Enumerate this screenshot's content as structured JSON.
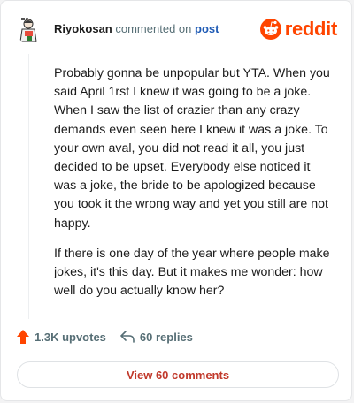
{
  "header": {
    "username": "Riyokosan",
    "action": "commented on",
    "post_link": "post",
    "brand": "reddit"
  },
  "comment": {
    "paragraphs": [
      "Probably gonna be unpopular but YTA. When you said April 1rst I knew it was going to be a joke. When I saw the list of crazier than any crazy demands even seen here I knew it was a joke. To your own aval, you did not read it all, you just decided to be upset. Everybody else noticed it was a joke, the bride to be apologized because you took it the wrong way and yet you still are not happy.",
      "If there is one day of the year where people make jokes, it's this day. But it makes me wonder: how well do you actually know her?"
    ]
  },
  "stats": {
    "upvotes": "1.3K upvotes",
    "replies": "60 replies"
  },
  "footer": {
    "view_button": "View 60 comments"
  },
  "colors": {
    "brand": "#ff4500",
    "link": "#1f5bb5",
    "muted": "#576f76"
  }
}
